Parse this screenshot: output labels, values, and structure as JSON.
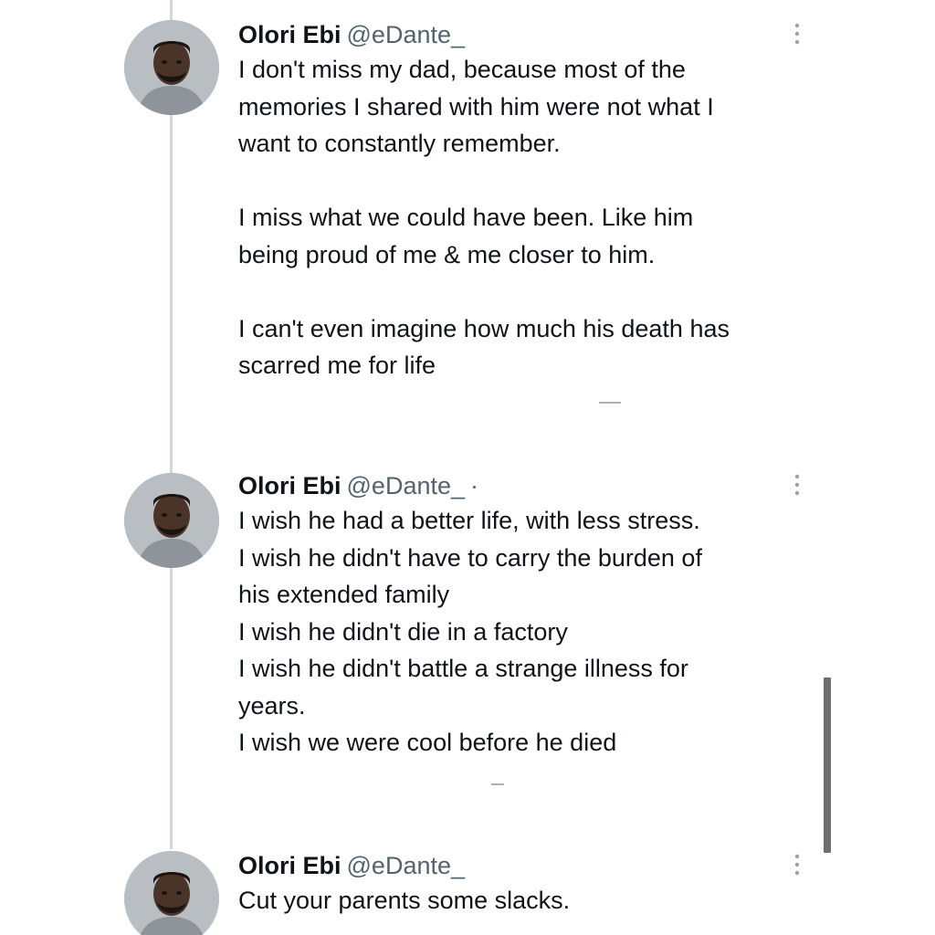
{
  "tweets": [
    {
      "author_name": "Olori Ebi",
      "author_handle": "@eDante_",
      "separator": "",
      "lines": [
        [
          "I don't miss my dad, because most of the",
          "memories I shared with him were not what I",
          "want to constantly remember."
        ],
        [
          "I miss what we could have been. Like him",
          "being proud of me & me closer to him."
        ],
        [
          "I can't even imagine how much his death has",
          "scarred me for life"
        ]
      ]
    },
    {
      "author_name": "Olori Ebi",
      "author_handle": "@eDante_",
      "separator": "·",
      "lines": [
        [
          "I wish he had a better life, with less stress.",
          "I wish he didn't have to carry the burden of",
          "his extended family",
          "I wish he didn't die in a factory",
          "I wish he didn't battle a strange illness for",
          "years.",
          "I wish we were cool before he died"
        ]
      ]
    },
    {
      "author_name": "Olori Ebi",
      "author_handle": "@eDante_",
      "separator": "",
      "lines": [
        [
          "Cut your parents some slacks."
        ]
      ]
    }
  ],
  "icons": {
    "more": "more-vertical-icon",
    "avatar": "profile-photo-avatar"
  },
  "colors": {
    "text": "#0f1419",
    "handle": "#536471",
    "thread_line": "#cfd9de",
    "scrollbar": "#6e6e6e"
  }
}
